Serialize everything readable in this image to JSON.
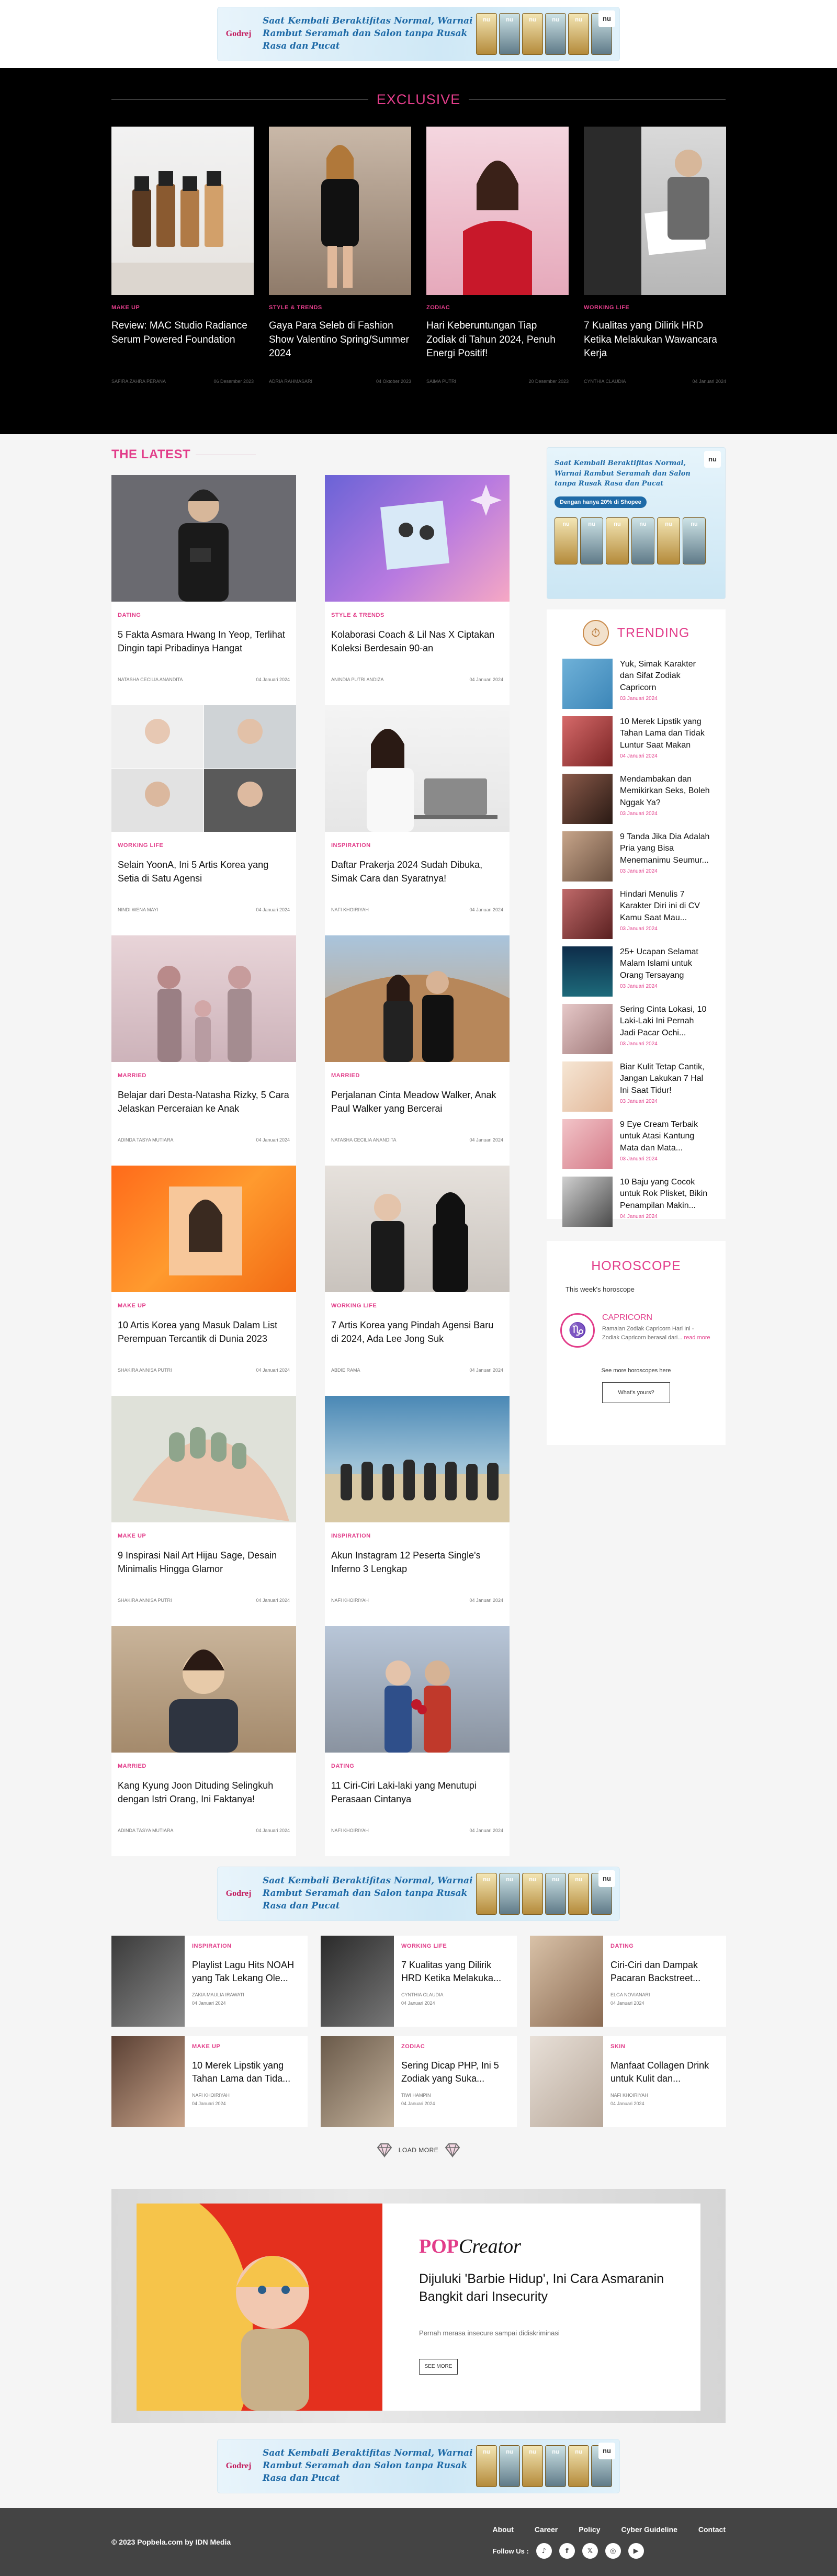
{
  "ads": {
    "brand": "Godrej",
    "top_text": "Saat Kembali Beraktifitas Normal, Warnai Rambut Seramah dan Salon tanpa Rusak Rasa dan Pucat",
    "side_text": "Saat Kembali Beraktifitas Normal, Warnai Rambut Seramah dan Salon tanpa Rusak Rasa dan Pucat",
    "side_pill": "Dengan hanya 20% di Shopee",
    "pack_label": "nu",
    "logo": "nu"
  },
  "exclusive": {
    "heading": "EXCLUSIVE",
    "items": [
      {
        "category": "MAKE UP",
        "title": "Review: MAC Studio Radiance Serum Powered Foundation",
        "author": "SAFIRA ZAHRA PERANA",
        "date": "06 Desember 2023"
      },
      {
        "category": "STYLE & TRENDS",
        "title": "Gaya Para Seleb di Fashion Show Valentino Spring/Summer 2024",
        "author": "ADRIA RAHMASARI",
        "date": "04 Oktober 2023"
      },
      {
        "category": "ZODIAC",
        "title": "Hari Keberuntungan Tiap Zodiak di Tahun 2024, Penuh Energi Positif!",
        "author": "SAIMA PUTRI",
        "date": "20 Desember 2023"
      },
      {
        "category": "WORKING LIFE",
        "title": "7 Kualitas yang Dilirik HRD Ketika Melakukan Wawancara Kerja",
        "author": "CYNTHIA CLAUDIA",
        "date": "04 Januari 2024"
      }
    ]
  },
  "latest": {
    "heading": "THE LATEST",
    "items": [
      {
        "category": "DATING",
        "title": "5 Fakta Asmara Hwang In Yeop, Terlihat Dingin tapi Pribadinya Hangat",
        "author": "NATASHA CECILIA ANANDITA",
        "date": "04 Januari 2024"
      },
      {
        "category": "STYLE & TRENDS",
        "title": "Kolaborasi Coach & Lil Nas X Ciptakan Koleksi Berdesain 90-an",
        "author": "ANINDIA PUTRI ANDIZA",
        "date": "04 Januari 2024"
      },
      {
        "category": "WORKING LIFE",
        "title": "Selain YoonA, Ini 5 Artis Korea yang Setia di Satu Agensi",
        "author": "NINDI WENA MAYI",
        "date": "04 Januari 2024"
      },
      {
        "category": "INSPIRATION",
        "title": "Daftar Prakerja 2024 Sudah Dibuka, Simak Cara dan Syaratnya!",
        "author": "NAFI KHOIRIYAH",
        "date": "04 Januari 2024"
      },
      {
        "category": "MARRIED",
        "title": "Belajar dari Desta-Natasha Rizky, 5 Cara Jelaskan Perceraian ke Anak",
        "author": "ADINDA TASYA MUTIARA",
        "date": "04 Januari 2024"
      },
      {
        "category": "MARRIED",
        "title": "Perjalanan Cinta Meadow Walker, Anak Paul Walker yang Bercerai",
        "author": "NATASHA CECILIA ANANDITA",
        "date": "04 Januari 2024"
      },
      {
        "category": "MAKE UP",
        "title": "10 Artis Korea yang Masuk Dalam List Perempuan Tercantik di Dunia 2023",
        "author": "SHAKIRA ANNISA PUTRI",
        "date": "04 Januari 2024"
      },
      {
        "category": "WORKING LIFE",
        "title": "7 Artis Korea yang Pindah Agensi Baru di 2024, Ada Lee Jong Suk",
        "author": "ABDIE RAMA",
        "date": "04 Januari 2024"
      },
      {
        "category": "MAKE UP",
        "title": "9 Inspirasi Nail Art Hijau Sage, Desain Minimalis Hingga Glamor",
        "author": "SHAKIRA ANNISA PUTRI",
        "date": "04 Januari 2024"
      },
      {
        "category": "INSPIRATION",
        "title": "Akun Instagram 12 Peserta Single's Inferno 3 Lengkap",
        "author": "NAFI KHOIRIYAH",
        "date": "04 Januari 2024"
      },
      {
        "category": "MARRIED",
        "title": "Kang Kyung Joon Dituding Selingkuh dengan Istri Orang, Ini Faktanya!",
        "author": "ADINDA TASYA MUTIARA",
        "date": "04 Januari 2024"
      },
      {
        "category": "DATING",
        "title": "11 Ciri-Ciri Laki-laki yang Menutupi Perasaan Cintanya",
        "author": "NAFI KHOIRIYAH",
        "date": "04 Januari 2024"
      }
    ]
  },
  "trending": {
    "heading": "TRENDING",
    "items": [
      {
        "title": "Yuk, Simak Karakter dan Sifat Zodiak Capricorn",
        "date": "03 Januari 2024"
      },
      {
        "title": "10 Merek Lipstik yang Tahan Lama dan Tidak Luntur Saat Makan",
        "date": "04 Januari 2024"
      },
      {
        "title": "Mendambakan dan Memikirkan Seks, Boleh Nggak Ya?",
        "date": "03 Januari 2024"
      },
      {
        "title": "9 Tanda Jika Dia Adalah Pria yang Bisa Menemanimu Seumur...",
        "date": "03 Januari 2024"
      },
      {
        "title": "Hindari Menulis 7 Karakter Diri ini di CV Kamu Saat Mau...",
        "date": "03 Januari 2024"
      },
      {
        "title": "25+ Ucapan Selamat Malam Islami untuk Orang Tersayang",
        "date": "03 Januari 2024"
      },
      {
        "title": "Sering Cinta Lokasi, 10 Laki-Laki Ini Pernah Jadi Pacar Ochi...",
        "date": "03 Januari 2024"
      },
      {
        "title": "Biar Kulit Tetap Cantik, Jangan Lakukan 7 Hal Ini Saat Tidur!",
        "date": "03 Januari 2024"
      },
      {
        "title": "9 Eye Cream Terbaik untuk Atasi Kantung Mata dan Mata...",
        "date": "03 Januari 2024"
      },
      {
        "title": "10 Baju yang Cocok untuk Rok Plisket, Bikin Penampilan Makin...",
        "date": "04 Januari 2024"
      }
    ]
  },
  "horoscope": {
    "heading": "HOROSCOPE",
    "subheading": "This week's horoscope",
    "sign": "CAPRICORN",
    "sign_glyph": "♑",
    "desc": "Ramalan Zodiak Capricorn Hari Ini - Zodiak Capricorn berasal dari...",
    "read_more": "read more",
    "more_text": "See more horoscopes here",
    "button": "What's yours?"
  },
  "more_articles": [
    {
      "category": "INSPIRATION",
      "title": "Playlist Lagu Hits NOAH yang Tak Lekang Ole...",
      "author": "ZAKIA MAULIA IRAWATI",
      "date": "04 Januari 2024"
    },
    {
      "category": "WORKING LIFE",
      "title": "7 Kualitas yang Dilirik HRD Ketika Melakuka...",
      "author": "CYNTHIA CLAUDIA",
      "date": "04 Januari 2024"
    },
    {
      "category": "DATING",
      "title": "Ciri-Ciri dan Dampak Pacaran Backstreet...",
      "author": "ELGA NOVIANARI",
      "date": "04 Januari 2024"
    },
    {
      "category": "MAKE UP",
      "title": "10 Merek Lipstik yang Tahan Lama dan Tida...",
      "author": "NAFI KHOIRIYAH",
      "date": "04 Januari 2024"
    },
    {
      "category": "ZODIAC",
      "title": "Sering Dicap PHP, Ini 5 Zodiak yang Suka...",
      "author": "TIWI HAMPIN",
      "date": "04 Januari 2024"
    },
    {
      "category": "SKIN",
      "title": "Manfaat Collagen Drink untuk Kulit dan...",
      "author": "NAFI KHOIRIYAH",
      "date": "04 Januari 2024"
    }
  ],
  "load_more": "LOAD MORE",
  "creator": {
    "logo_a": "POP",
    "logo_b": "Creator",
    "title": "Dijuluki 'Barbie Hidup', Ini Cara Asmaranin Bangkit dari Insecurity",
    "desc": "Pernah merasa insecure sampai didiskriminasi",
    "button": "SEE MORE"
  },
  "footer": {
    "copyright": "© 2023 Popbela.com by IDN Media",
    "links": [
      "About",
      "Career",
      "Policy",
      "Cyber Guideline",
      "Contact"
    ],
    "follow": "Follow Us :",
    "socials": [
      "♪",
      "f",
      "𝕏",
      "◎",
      "▶"
    ]
  },
  "colors": {
    "accent": "#e23d8a",
    "footer": "#444444",
    "exclusive_bg": "#000000"
  }
}
